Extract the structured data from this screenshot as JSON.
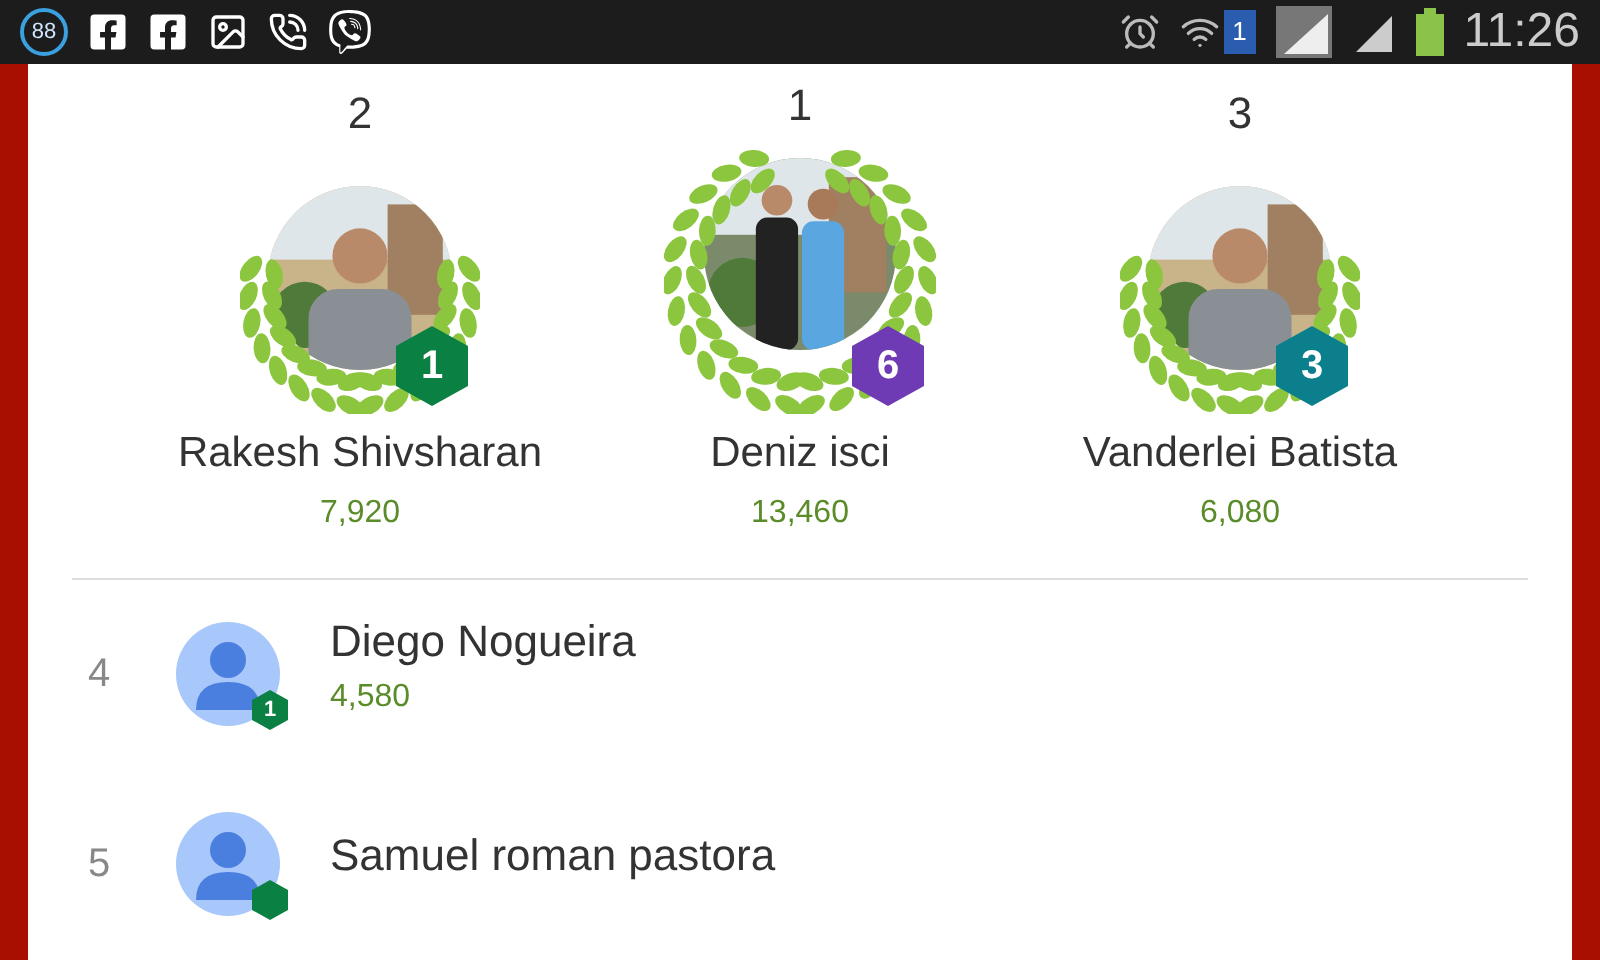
{
  "status_bar": {
    "notification_count": "88",
    "sim_slot": "1",
    "time": "11:26"
  },
  "podium": [
    {
      "rank": "2",
      "name": "Rakesh Shivsharan",
      "score": "7,920",
      "badge": "1",
      "color": "#0b8043",
      "kind": "runner_up"
    },
    {
      "rank": "1",
      "name": "Deniz isci",
      "score": "13,460",
      "badge": "6",
      "color": "#6f3bb5",
      "kind": "winner"
    },
    {
      "rank": "3",
      "name": "Vanderlei Batista",
      "score": "6,080",
      "badge": "3",
      "color": "#0b7f8c",
      "kind": "runner_up"
    }
  ],
  "rows": [
    {
      "rank": "4",
      "name": "Diego Nogueira",
      "score": "4,580",
      "badge": "1",
      "color": "#0b8043"
    },
    {
      "rank": "5",
      "name": "Samuel roman pastora",
      "color": "#0b8043"
    }
  ]
}
